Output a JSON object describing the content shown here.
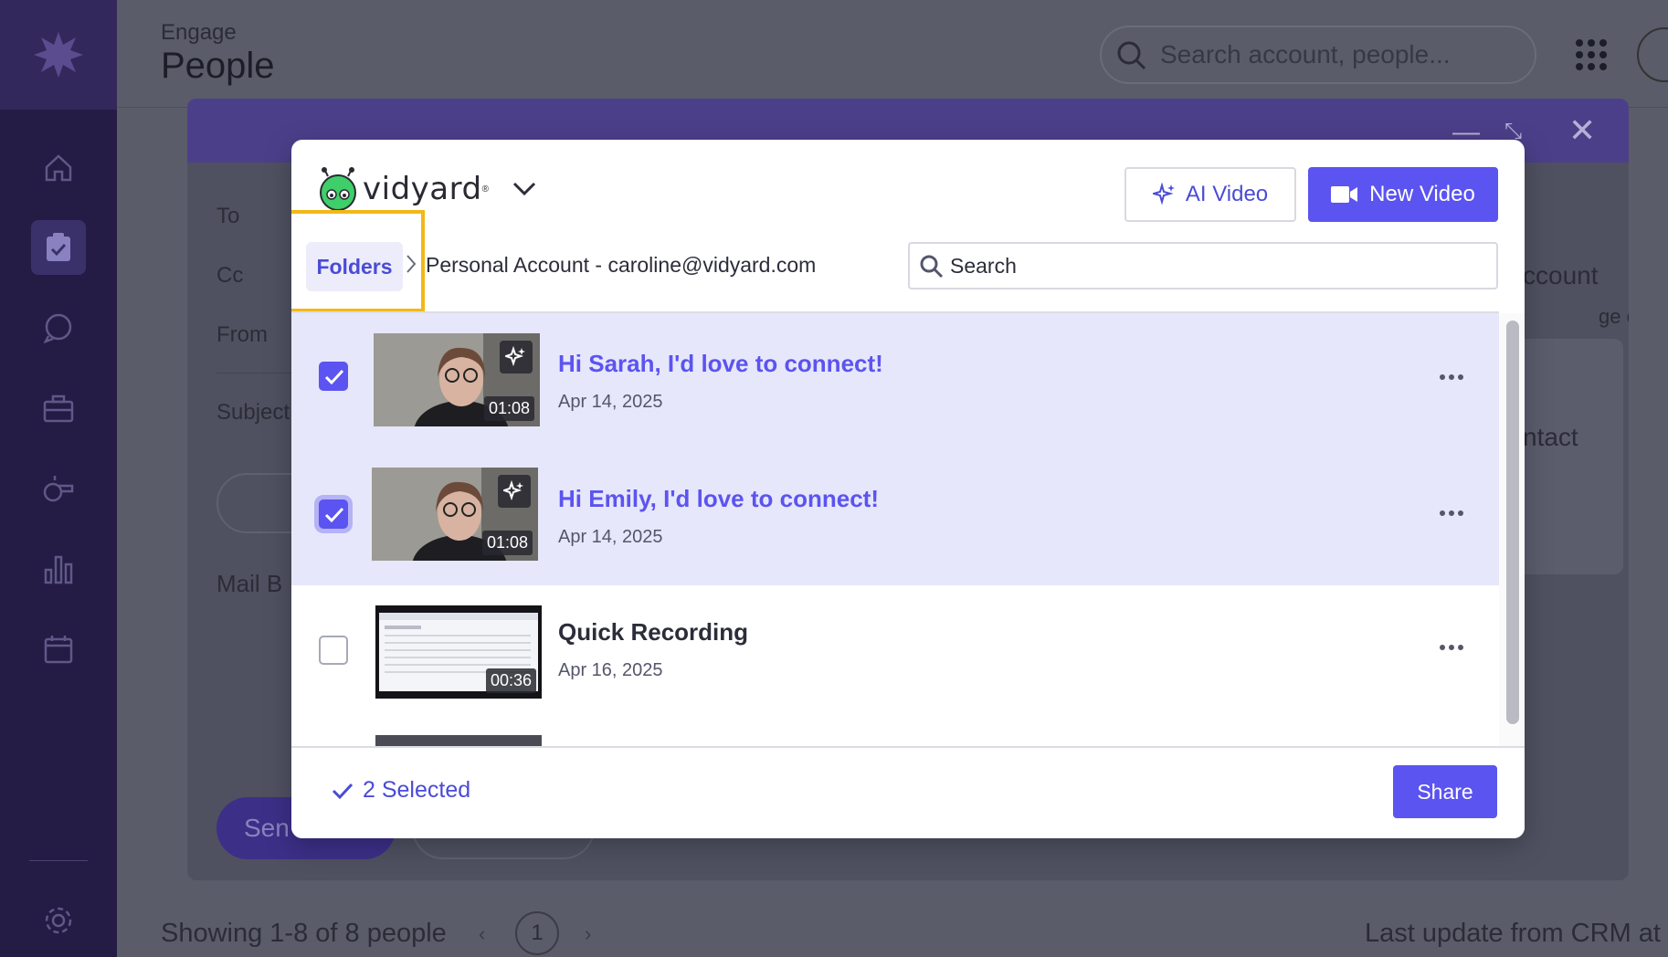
{
  "app": {
    "section": "Engage",
    "page_title": "People",
    "search_placeholder": "Search account, people...",
    "footer_text": "Showing 1-8 of 8 people",
    "current_page": "1",
    "last_update": "Last update from CRM at"
  },
  "composer": {
    "to_label": "To",
    "cc_label": "Cc",
    "from_label": "From",
    "subject_label": "Subject",
    "mail_body_label": "Mail B",
    "send_label": "Sen",
    "account_label": "ccount",
    "contact_label": "ntact",
    "engage_label": "ge c"
  },
  "modal": {
    "brand": "vidyard",
    "ai_video_label": "AI Video",
    "new_video_label": "New Video",
    "breadcrumb_folders": "Folders",
    "breadcrumb_account": "Personal Account - caroline@vidyard.com",
    "search_placeholder": "Search",
    "videos": [
      {
        "title": "Hi Sarah, I'd love to connect!",
        "date": "Apr 14, 2025",
        "duration": "01:08",
        "selected": true,
        "ai": true
      },
      {
        "title": "Hi Emily, I'd love to connect!",
        "date": "Apr 14, 2025",
        "duration": "01:08",
        "selected": true,
        "ai": true
      },
      {
        "title": "Quick Recording",
        "date": "Apr 16, 2025",
        "duration": "00:36",
        "selected": false,
        "ai": false
      }
    ],
    "selected_count_label": "2 Selected",
    "share_label": "Share"
  },
  "colors": {
    "accent": "#5b54f0",
    "highlight": "#f2b818",
    "sidebar": "#241c44"
  }
}
